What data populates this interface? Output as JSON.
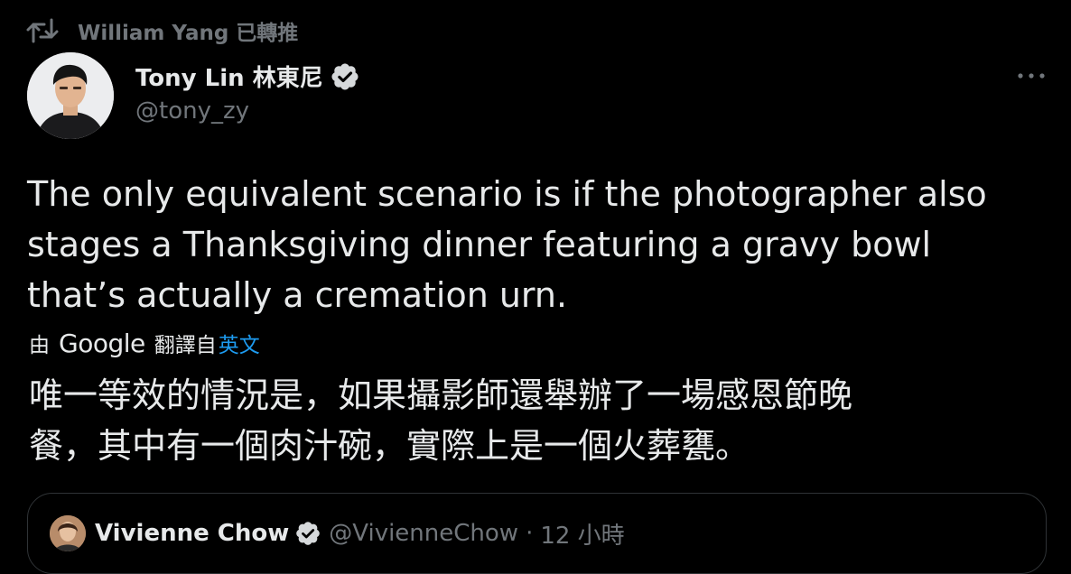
{
  "retweet": {
    "text": "William Yang 已轉推",
    "icon": "retweet-icon"
  },
  "tweet": {
    "display_name": "Tony Lin 林東尼",
    "handle": "@tony_zy",
    "verified_icon": "verified-badge-icon",
    "more_icon": "more-options-icon",
    "text_lines": [
      "The only equivalent scenario is if the photographer also",
      "stages a Thanksgiving dinner featuring a gravy bowl",
      "that’s actually a cremation urn."
    ]
  },
  "translation": {
    "prefix": "由",
    "provider": "Google",
    "suffix": "翻譯自",
    "language": "英文",
    "text_lines": [
      "唯一等效的情況是，如果攝影師還舉辦了一場感恩節晚",
      "餐，其中有一個肉汁碗，實際上是一個火葬甕。"
    ]
  },
  "quote": {
    "display_name": "Vivienne Chow",
    "handle": "@VivienneChow",
    "separator": "·",
    "time": "12 小時"
  },
  "colors": {
    "background": "#000000",
    "text_primary": "#e7e9ea",
    "text_secondary": "#71767b",
    "link": "#1d9bf0",
    "border": "#2f3336"
  }
}
